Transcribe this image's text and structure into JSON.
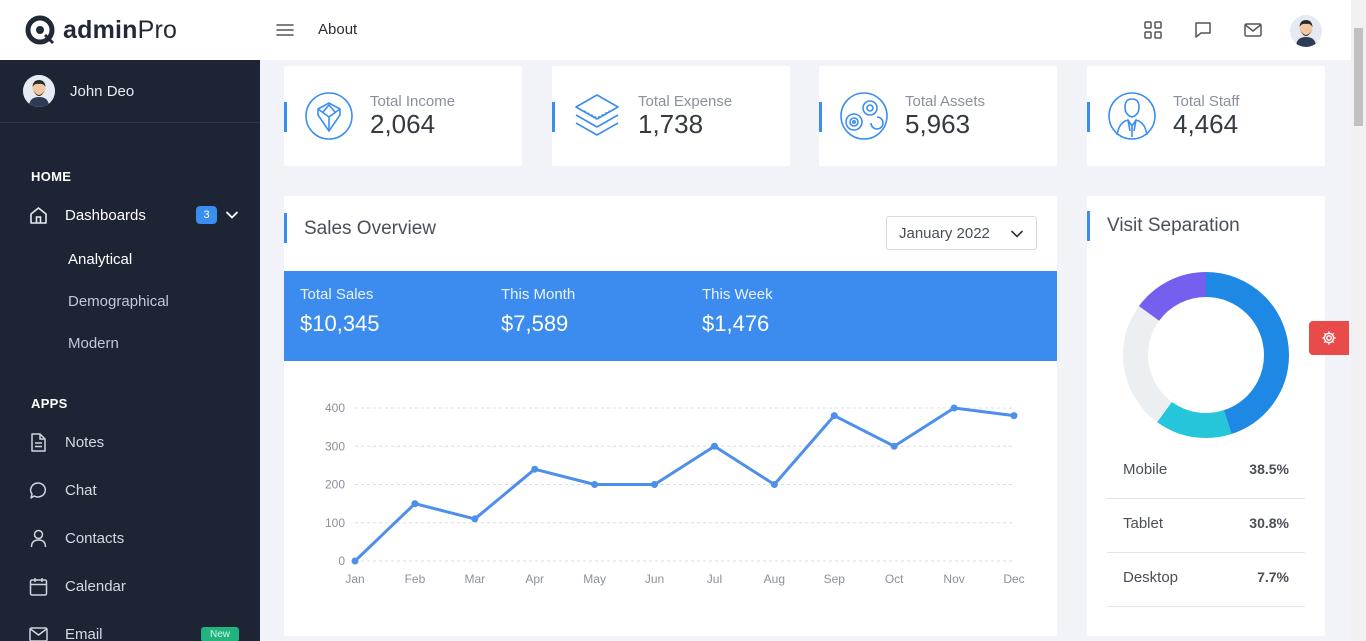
{
  "header": {
    "logo_bold": "admin",
    "logo_light": "Pro",
    "about_label": "About",
    "icons": [
      "grid-icon",
      "chat-icon",
      "mail-icon",
      "avatar"
    ]
  },
  "sidebar": {
    "user_name": "John Deo",
    "home_title": "HOME",
    "dashboards_label": "Dashboards",
    "dashboards_count": "3",
    "sub_items": [
      "Analytical",
      "Demographical",
      "Modern"
    ],
    "apps_title": "APPS",
    "apps": [
      {
        "label": "Notes",
        "icon": "notes-icon"
      },
      {
        "label": "Chat",
        "icon": "chat-icon"
      },
      {
        "label": "Contacts",
        "icon": "user-icon"
      },
      {
        "label": "Calendar",
        "icon": "calendar-icon"
      },
      {
        "label": "Email",
        "icon": "mail-icon",
        "badge": "New"
      }
    ]
  },
  "stats": [
    {
      "label": "Total Income",
      "value": "2,064",
      "icon": "income-icon"
    },
    {
      "label": "Total Expense",
      "value": "1,738",
      "icon": "expense-icon"
    },
    {
      "label": "Total Assets",
      "value": "5,963",
      "icon": "assets-icon"
    },
    {
      "label": "Total Staff",
      "value": "4,464",
      "icon": "staff-icon"
    }
  ],
  "sales": {
    "title": "Sales Overview",
    "selected_month": "January 2022",
    "summary": [
      {
        "label": "Total Sales",
        "value": "$10,345"
      },
      {
        "label": "This Month",
        "value": "$7,589"
      },
      {
        "label": "This Week",
        "value": "$1,476"
      }
    ]
  },
  "chart_data": {
    "type": "line",
    "categories": [
      "Jan",
      "Feb",
      "Mar",
      "Apr",
      "May",
      "Jun",
      "Jul",
      "Aug",
      "Sep",
      "Oct",
      "Nov",
      "Dec"
    ],
    "values": [
      0,
      150,
      110,
      240,
      200,
      200,
      300,
      200,
      380,
      300,
      400,
      380
    ],
    "yticks": [
      0,
      100,
      200,
      300,
      400
    ],
    "ylim": [
      0,
      400
    ],
    "grid": true,
    "color": "#4d8fea"
  },
  "visits": {
    "title": "Visit Separation",
    "items": [
      {
        "label": "Mobile",
        "value": "38.5%"
      },
      {
        "label": "Tablet",
        "value": "30.8%"
      },
      {
        "label": "Desktop",
        "value": "7.7%"
      }
    ],
    "donut_segments": [
      {
        "value": 45,
        "color": "#1e88e5"
      },
      {
        "value": 15,
        "color": "#26c6da"
      },
      {
        "value": 25,
        "color": "#eceff1"
      },
      {
        "value": 15,
        "color": "#7460ee"
      }
    ]
  },
  "colors": {
    "accent": "#3a8ef0",
    "sidebar": "#1d2433",
    "fab": "#e94b4b",
    "new_badge": "#21b47f"
  }
}
